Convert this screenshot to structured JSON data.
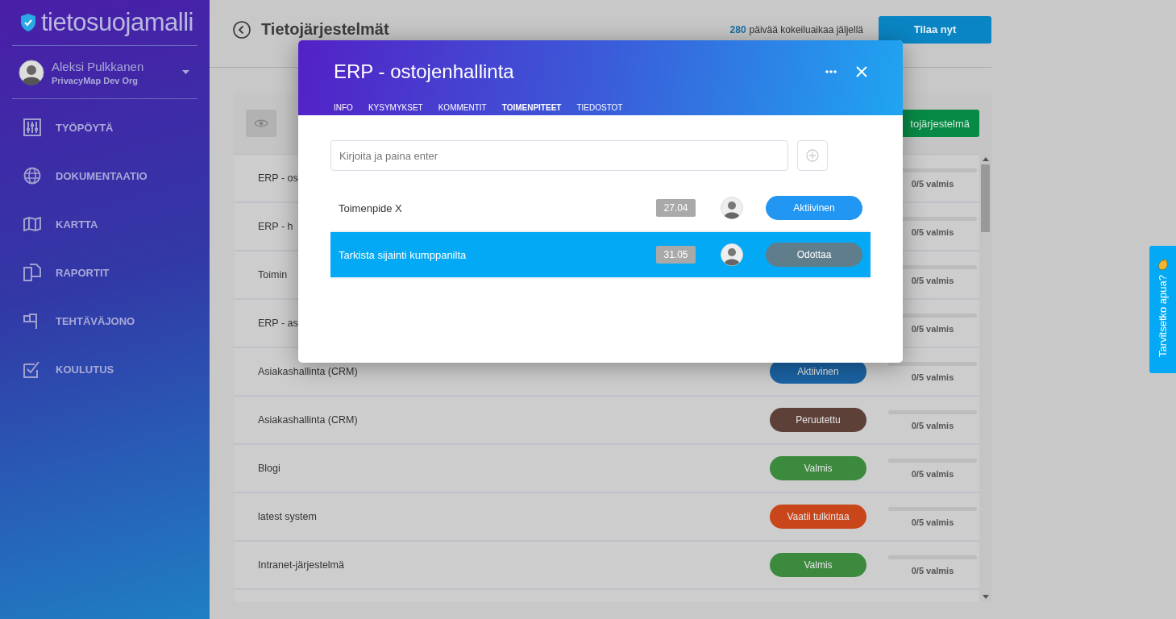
{
  "sidebar": {
    "logo": "tietosuojamalli",
    "user": {
      "name": "Aleksi Pulkkanen",
      "org": "PrivacyMap Dev Org"
    },
    "items": [
      {
        "label": "TYÖPÖYTÄ"
      },
      {
        "label": "DOKUMENTAATIO"
      },
      {
        "label": "KARTTA"
      },
      {
        "label": "RAPORTIT"
      },
      {
        "label": "TEHTÄVÄJONO"
      },
      {
        "label": "KOULUTUS"
      }
    ]
  },
  "header": {
    "title": "Tietojärjestelmät",
    "trial_days": "280",
    "trial_text": "päivää kokeiluaikaa jäljellä",
    "subscribe_button": "Tilaa nyt"
  },
  "toolbar": {
    "add_button": "tojärjestelmä"
  },
  "systems": [
    {
      "name": "ERP - os",
      "progress": "0/5 valmis"
    },
    {
      "name": "ERP - h",
      "progress": "0/5 valmis"
    },
    {
      "name": "Toimin",
      "progress": "0/5 valmis"
    },
    {
      "name": "ERP - as",
      "progress": "0/5 valmis"
    },
    {
      "name": "Asiakashallinta (CRM)",
      "status": "Aktiivinen",
      "color": "#1a63a3",
      "progress": "0/5 valmis"
    },
    {
      "name": "Asiakashallinta (CRM)",
      "status": "Peruutettu",
      "color": "#5d4037",
      "progress": "0/5 valmis"
    },
    {
      "name": "Blogi",
      "status": "Valmis",
      "color": "#3b8a3e",
      "progress": "0/5 valmis"
    },
    {
      "name": "latest system",
      "status": "Vaatii tulkintaa",
      "color": "#c9461a",
      "progress": "0/5 valmis"
    },
    {
      "name": "Intranet-järjestelmä",
      "status": "Valmis",
      "color": "#3b8a3e",
      "progress": "0/5 valmis"
    }
  ],
  "modal": {
    "title": "ERP - ostojenhallinta",
    "tabs": [
      {
        "label": "INFO",
        "selected": false
      },
      {
        "label": "KYSYMYKSET",
        "selected": false
      },
      {
        "label": "KOMMENTIT",
        "selected": false
      },
      {
        "label": "TOIMENPITEET",
        "selected": true
      },
      {
        "label": "TIEDOSTOT",
        "selected": false
      }
    ],
    "input": {
      "placeholder": "Kirjoita ja paina enter"
    },
    "tasks": [
      {
        "name": "Toimenpide X",
        "date": "27.04",
        "status": "Aktiivinen",
        "color": "#2196f3",
        "selected": false
      },
      {
        "name": "Tarkista sijainti kumppanilta",
        "date": "31.05",
        "status": "Odottaa",
        "color": "#607d8b",
        "selected": true
      }
    ]
  },
  "help_tab": {
    "text": "Tarvitsetko apua?"
  }
}
